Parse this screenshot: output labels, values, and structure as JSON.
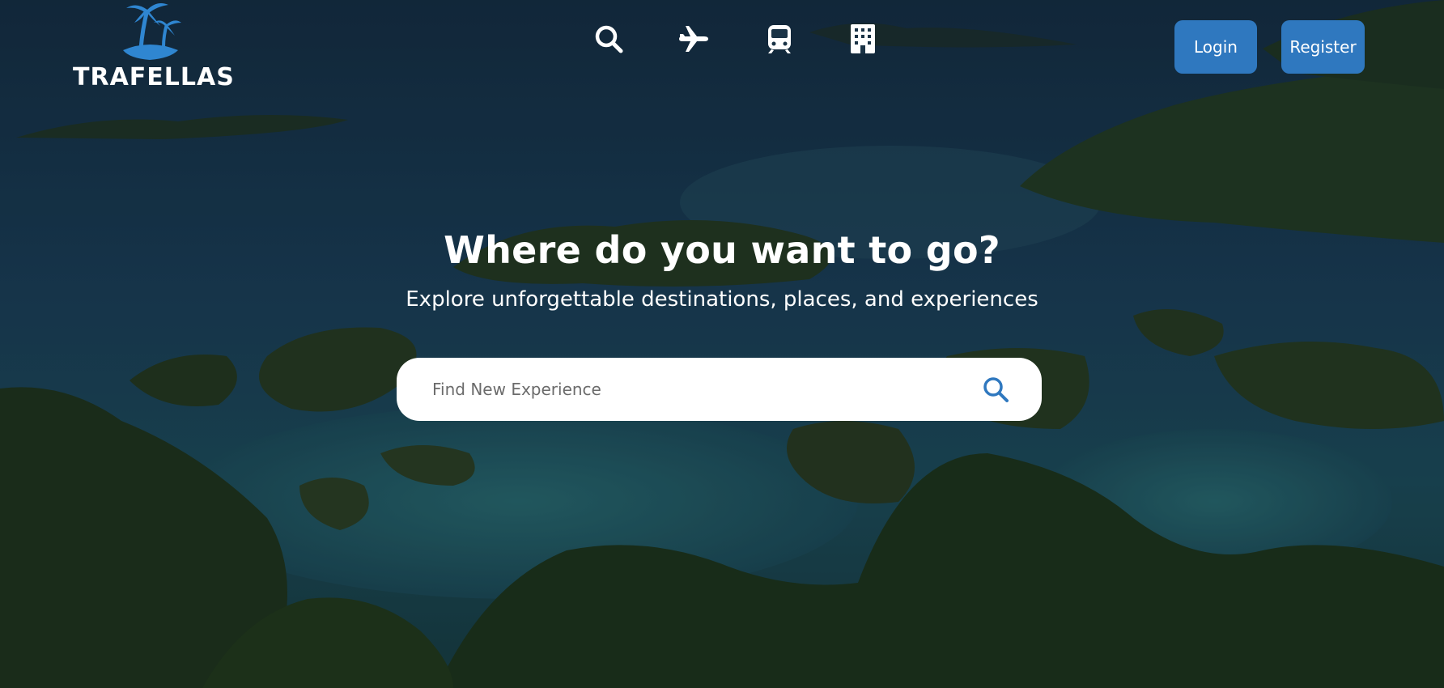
{
  "brand": {
    "name": "TRAFELLAS",
    "logo_icon": "palm-island-icon",
    "logo_color": "#2f86d1"
  },
  "nav": {
    "icons": [
      {
        "name": "search-icon"
      },
      {
        "name": "airplane-icon"
      },
      {
        "name": "train-icon"
      },
      {
        "name": "hotel-building-icon"
      }
    ]
  },
  "auth": {
    "login_label": "Login",
    "register_label": "Register",
    "button_color": "#2f78bf"
  },
  "hero": {
    "headline": "Where do you want to go?",
    "subline": "Explore unforgettable destinations, places, and experiences",
    "background": "aerial-view-of-tropical-islands"
  },
  "search": {
    "placeholder": "Find New Experience",
    "value": "",
    "icon": "search-icon",
    "icon_color": "#2f78bf"
  }
}
